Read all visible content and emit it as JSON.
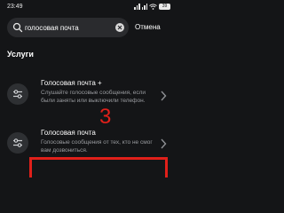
{
  "status_bar": {
    "time": "23:49",
    "battery": "39"
  },
  "search": {
    "value": "голосовая почта",
    "cancel_label": "Отмена"
  },
  "section": {
    "title": "Услуги"
  },
  "results": [
    {
      "title": "Голосовая почта +",
      "description": "Слушайте голосовые сообщения, если были заняты или выключили телефон.",
      "icon": "sliders-icon"
    },
    {
      "title": "Голосовая почта",
      "description": "Голосовые сообщения от тех, кто не смог вам дозвониться.",
      "icon": "sliders-icon"
    }
  ],
  "annotation": {
    "number": "3",
    "color": "#e0201a"
  },
  "colors": {
    "background": "#141517",
    "search_field": "#2a2b2e",
    "secondary_text": "#9a9ca0"
  }
}
